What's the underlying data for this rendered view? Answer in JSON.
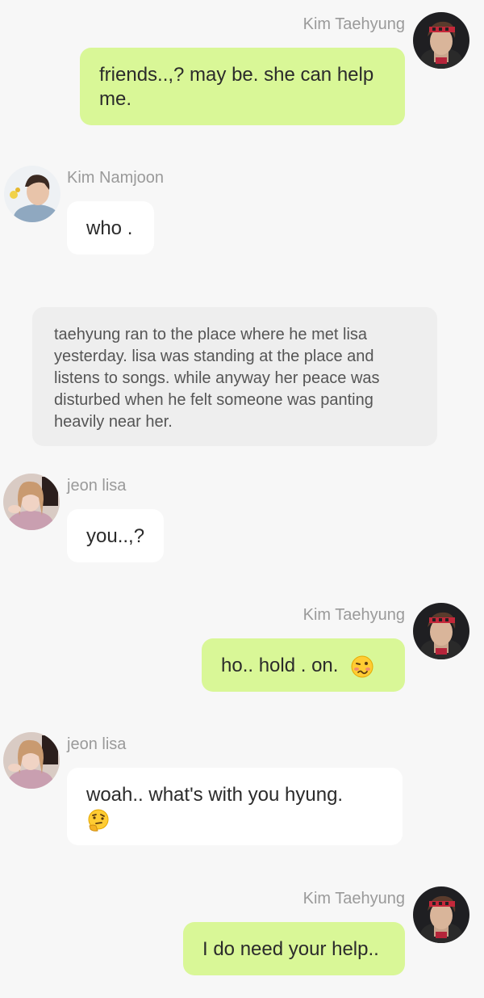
{
  "messages": [
    {
      "sender": "Kim Taehyung",
      "side": "right",
      "text": "friends..,? may be. she can help me."
    },
    {
      "sender": "Kim Namjoon",
      "side": "left",
      "text": "who ."
    },
    {
      "type": "narration",
      "text": "taehyung ran to the place where he met lisa yesterday.  lisa was standing at the place and listens to songs.  while anyway her peace was disturbed when he felt someone was panting heavily near her."
    },
    {
      "sender": "jeon lisa",
      "side": "left",
      "text": "you..,?"
    },
    {
      "sender": "Kim Taehyung",
      "side": "right",
      "text": "ho.. hold .  on.",
      "emoji": "woozy-face-icon"
    },
    {
      "sender": "jeon lisa",
      "side": "left",
      "text": "woah.. what's with you hyung.",
      "emoji": "thinking-face-icon"
    },
    {
      "sender": "Kim Taehyung",
      "side": "right",
      "text": "I do need your help.."
    }
  ],
  "colors": {
    "background": "#f7f7f7",
    "my_bubble": "#d9f797",
    "their_bubble": "#ffffff",
    "narration_bubble": "#eeeeee",
    "name_text": "#9a9a9a"
  }
}
